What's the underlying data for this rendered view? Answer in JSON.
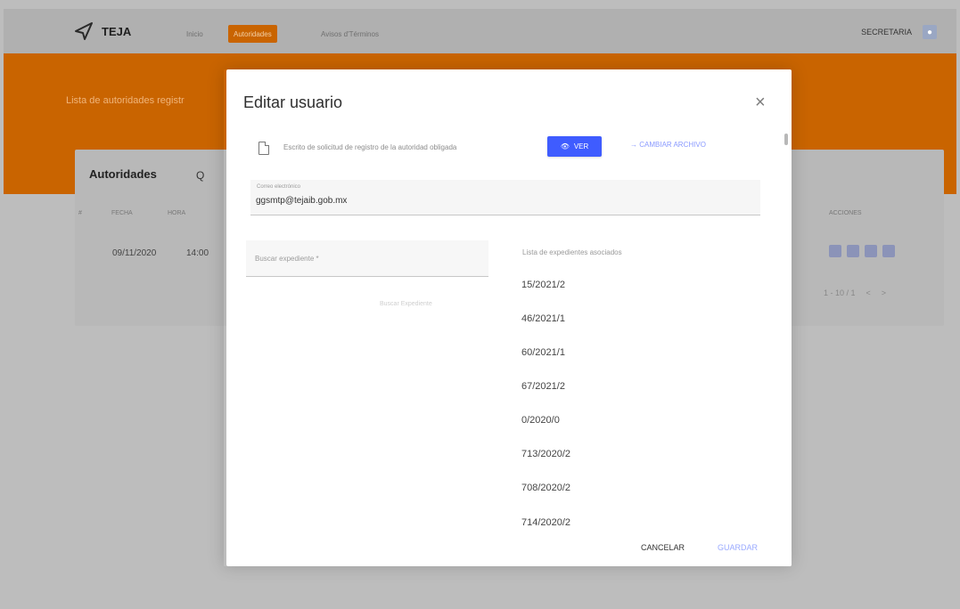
{
  "app": {
    "name": "TEJA",
    "nav": [
      {
        "label": "Inicio"
      },
      {
        "label": "Autoridades"
      },
      {
        "label": "Avisos d'Términos"
      }
    ],
    "user": "SECRETARIA"
  },
  "background": {
    "banner_text": "Lista de autoridades registr",
    "card": {
      "title": "Autoridades",
      "search": "Q",
      "headers": [
        "#",
        "FECHA",
        "HORA",
        "ACCIONES"
      ],
      "row": {
        "date": "09/11/2020",
        "time": "14:00"
      },
      "paginator": [
        "1 - 10 / 1",
        "<",
        ">"
      ]
    }
  },
  "modal": {
    "title": "Editar usuario",
    "close": "×",
    "document_text": "Escrito de solicitud de registro de la autoridad obligada",
    "view_button": "VER",
    "change_file_button": "CAMBIAR ARCHIVO",
    "email_label": "Correo electrónico",
    "email_value": "ggsmtp@tejaib.gob.mx",
    "search_placeholder": "Buscar expediente *",
    "search_hint": "Buscar Expediente",
    "list_title": "Lista de expedientes asociados",
    "expedientes": [
      "15/2021/2",
      "46/2021/1",
      "60/2021/1",
      "67/2021/2",
      "0/2020/0",
      "713/2020/2",
      "708/2020/2",
      "714/2020/2"
    ],
    "cancel_button": "CANCELAR",
    "save_button": "GUARDAR"
  }
}
